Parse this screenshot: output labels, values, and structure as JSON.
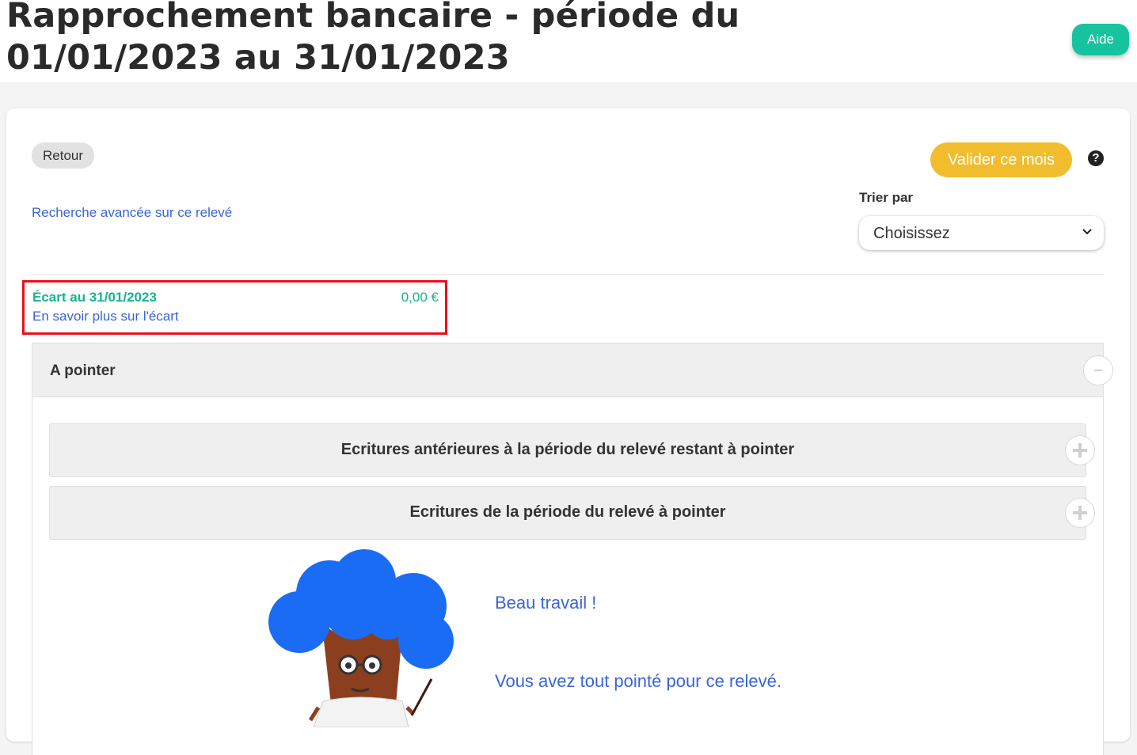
{
  "header": {
    "title": "Rapprochement bancaire - période du 01/01/2023 au 31/01/2023",
    "help_label": "Aide"
  },
  "toolbar": {
    "back_label": "Retour",
    "validate_label": "Valider ce mois",
    "help_icon": "question-circle-icon"
  },
  "search": {
    "advanced_link": "Recherche avancée sur ce relevé"
  },
  "sort": {
    "label": "Trier par",
    "selected": "Choisissez"
  },
  "gap": {
    "label": "Écart au 31/01/2023",
    "amount": "0,00 €",
    "learn_more": "En savoir plus sur l'écart"
  },
  "to_check": {
    "title": "A pointer",
    "toggle_icon": "minus-icon",
    "accordions": [
      {
        "title": "Ecritures antérieures à la période du relevé restant à pointer",
        "icon": "plus-icon"
      },
      {
        "title": "Ecritures de la période du relevé à pointer",
        "icon": "plus-icon"
      }
    ]
  },
  "empty_state": {
    "line1": "Beau travail !",
    "line2": "Vous avez tout pointé pour ce relevé.",
    "illustration": "tree-mascot-illustration"
  },
  "colors": {
    "accent_green": "#17c39c",
    "accent_yellow": "#f2bd2c",
    "link_blue": "#3a64d8",
    "highlight_red": "#e8101a"
  }
}
